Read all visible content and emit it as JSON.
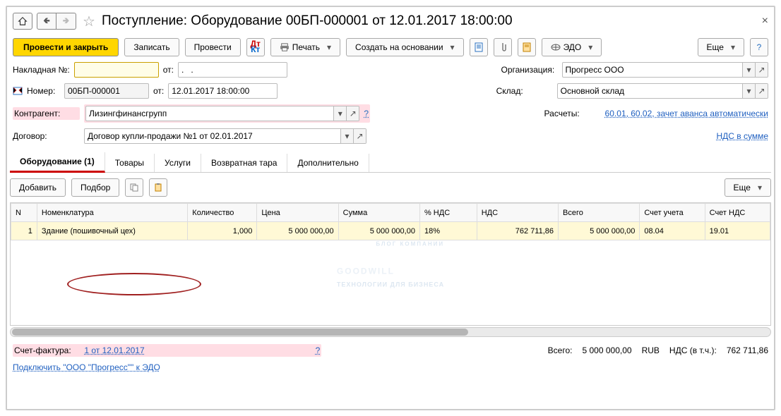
{
  "title": "Поступление: Оборудование 00БП-000001 от 12.01.2017 18:00:00",
  "toolbar": {
    "post_close": "Провести и закрыть",
    "write": "Записать",
    "post": "Провести",
    "print": "Печать",
    "create_based": "Создать на основании",
    "edo": "ЭДО",
    "more": "Еще"
  },
  "form": {
    "invoice_label": "Накладная №:",
    "invoice_no": "",
    "from_label": "от:",
    "from1": ".   .",
    "number_label": "Номер:",
    "number": "00БП-000001",
    "date": "12.01.2017 18:00:00",
    "org_label": "Организация:",
    "org": "Прогресс ООО",
    "warehouse_label": "Склад:",
    "warehouse": "Основной склад",
    "counterparty_label": "Контрагент:",
    "counterparty": "Лизингфинансгрупп",
    "contract_label": "Договор:",
    "contract": "Договор купли-продажи №1 от 02.01.2017",
    "settlements_label": "Расчеты:",
    "settlements_link": "60.01, 60.02, зачет аванса автоматически",
    "vat_link": "НДС в сумме"
  },
  "tabs": [
    "Оборудование (1)",
    "Товары",
    "Услуги",
    "Возвратная тара",
    "Дополнительно"
  ],
  "tabbuttons": {
    "add": "Добавить",
    "pick": "Подбор",
    "more": "Еще"
  },
  "grid": {
    "headers": [
      "N",
      "Номенклатура",
      "Количество",
      "Цена",
      "Сумма",
      "% НДС",
      "НДС",
      "Всего",
      "Счет учета",
      "Счет НДС"
    ],
    "row": {
      "n": "1",
      "item": "Здание (пошивочный цех)",
      "qty": "1,000",
      "price": "5 000 000,00",
      "sum": "5 000 000,00",
      "vat_rate": "18%",
      "vat": "762 711,86",
      "total": "5 000 000,00",
      "acct": "08.04",
      "acct_vat": "19.01"
    }
  },
  "footer": {
    "invoice_fact_label": "Счет-фактура:",
    "invoice_fact_link": "1 от 12.01.2017",
    "connect_link": "Подключить \"OOO \"Прогресс\"\" к ЭДО",
    "totals_label": "Всего:",
    "totals_sum": "5 000 000,00",
    "currency": "RUB",
    "vat_label": "НДС (в т.ч.):",
    "vat_sum": "762 711,86"
  },
  "watermark": {
    "top": "БЛОГ КОМПАНИИ",
    "main": "GOODWILL",
    "sub": "ТЕХНОЛОГИИ   ДЛЯ   БИЗНЕСА"
  }
}
